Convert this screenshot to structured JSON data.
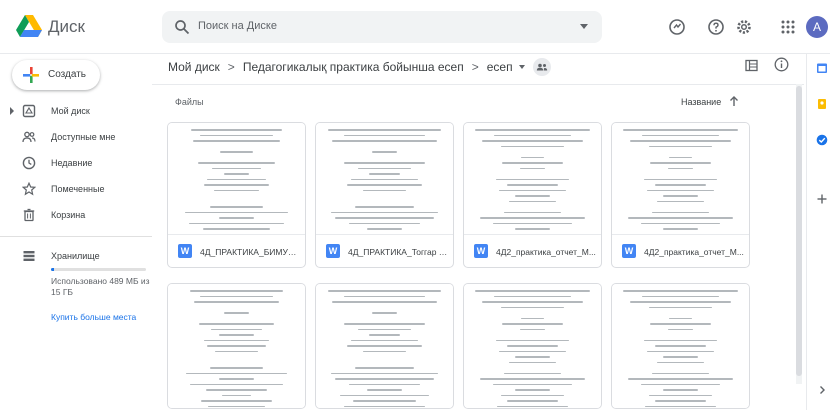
{
  "app": {
    "name": "Диск"
  },
  "search": {
    "placeholder": "Поиск на Диске"
  },
  "user": {
    "avatar_letter": "A"
  },
  "sidebar": {
    "new_label": "Создать",
    "items": [
      {
        "label": "Мой диск",
        "icon": "my-drive-icon"
      },
      {
        "label": "Доступные мне",
        "icon": "shared-with-me-icon"
      },
      {
        "label": "Недавние",
        "icon": "recent-icon"
      },
      {
        "label": "Помеченные",
        "icon": "star-icon"
      },
      {
        "label": "Корзина",
        "icon": "trash-icon"
      }
    ],
    "storage": {
      "label": "Хранилище",
      "used_text": "Использовано 489 МБ из 15 ГБ",
      "used_fraction": 0.032,
      "buy_label": "Купить больше места"
    }
  },
  "breadcrumb": {
    "items": [
      "Мой диск",
      "Педагогикалық практика бойынша есеп",
      "есеп"
    ]
  },
  "files": {
    "section_label": "Файлы",
    "sort_label": "Название",
    "items": [
      {
        "name": "4Д_ПРАКТИКА_БИМУХ...",
        "type": "W"
      },
      {
        "name": "4Д_ПРАКТИКА_Тоггар А...",
        "type": "W"
      },
      {
        "name": "4Д2_практика_отчет_М...",
        "type": "W"
      },
      {
        "name": "4Д2_практика_отчет_М...",
        "type": "W"
      },
      {
        "name": "",
        "type": ""
      },
      {
        "name": "",
        "type": ""
      },
      {
        "name": "",
        "type": ""
      },
      {
        "name": "",
        "type": ""
      }
    ]
  },
  "colors": {
    "accent": "#1a73e8",
    "word_blue": "#4285f4",
    "avatar": "#5c6bc0"
  }
}
